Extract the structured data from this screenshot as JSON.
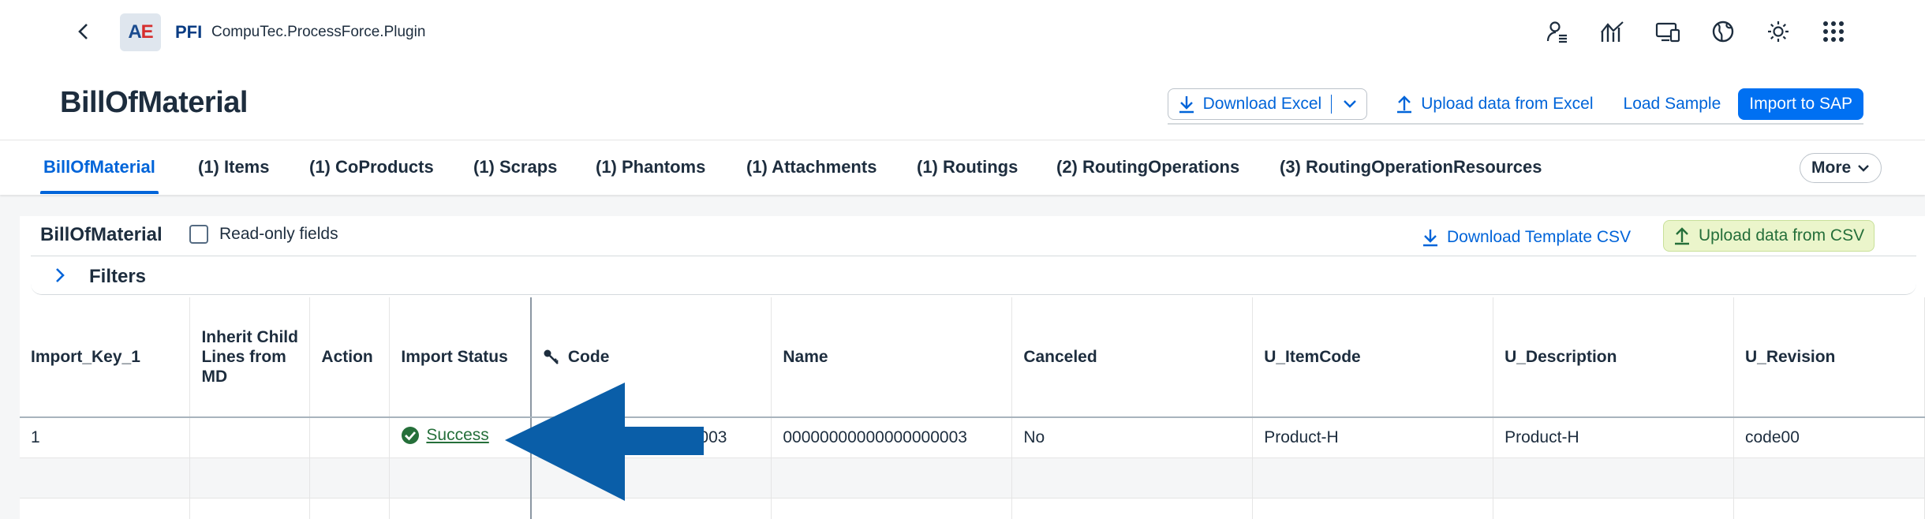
{
  "shell": {
    "logo_a": "A",
    "logo_e": "E",
    "app_short": "PFI",
    "app_name": "CompuTec.ProcessForce.Plugin",
    "icons": [
      "user-settings-icon",
      "analytics-icon",
      "devices-icon",
      "globe-icon",
      "theme-sun-icon",
      "app-grid-icon"
    ]
  },
  "header": {
    "title": "BillOfMaterial",
    "download_excel": "Download Excel",
    "upload_excel": "Upload data from Excel",
    "load_sample": "Load Sample",
    "import_sap": "Import to SAP"
  },
  "tabs": [
    "BillOfMaterial",
    "(1) Items",
    "(1) CoProducts",
    "(1) Scraps",
    "(1) Phantoms",
    "(1) Attachments",
    "(1) Routings",
    "(2) RoutingOperations",
    "(3) RoutingOperationResources"
  ],
  "more_label": "More",
  "table": {
    "title": "BillOfMaterial",
    "readonly_label": "Read-only fields",
    "download_template": "Download Template CSV",
    "upload_csv": "Upload data from CSV",
    "filters_label": "Filters",
    "columns": [
      "Import_Key_1",
      "Inherit Child Lines from MD",
      "Action",
      "Import Status",
      "Code",
      "Name",
      "Canceled",
      "U_ItemCode",
      "U_Description",
      "U_Revision"
    ],
    "rows": [
      {
        "import_key": "1",
        "inherit": "",
        "action": "",
        "status": "Success",
        "code": "00000000000000000003",
        "name": "00000000000000000003",
        "canceled": "No",
        "item_code": "Product-H",
        "description": "Product-H",
        "revision": "code00"
      }
    ]
  },
  "colors": {
    "accent": "#0064d9",
    "primary": "#0070f2",
    "success": "#256f3a",
    "arrow": "#0a5ea8"
  }
}
